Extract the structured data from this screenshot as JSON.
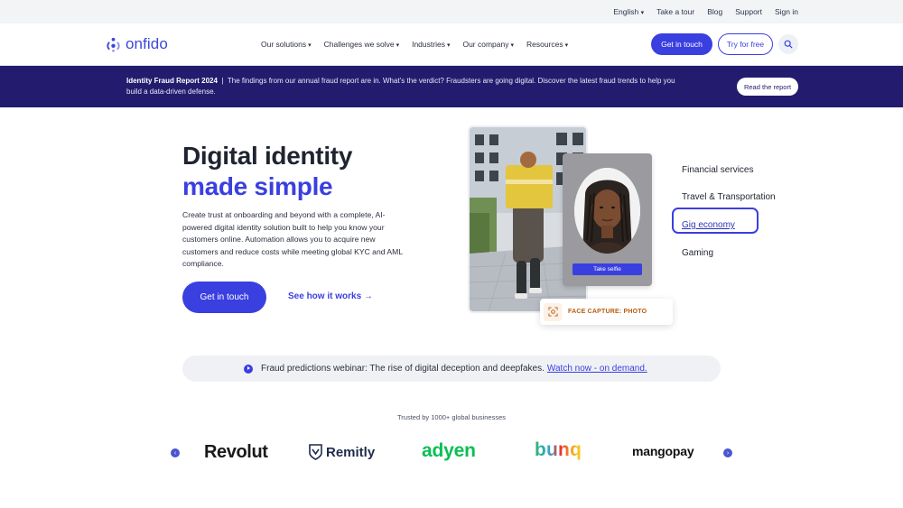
{
  "utility": {
    "language": "English",
    "links": [
      "Take a tour",
      "Blog",
      "Support",
      "Sign in"
    ]
  },
  "nav": {
    "logo_text": "onfido",
    "menu": [
      "Our solutions",
      "Challenges we solve",
      "Industries",
      "Our company",
      "Resources"
    ],
    "cta_label": "Get in touch",
    "try_label": "Try for free",
    "search_icon": "search-icon"
  },
  "banner": {
    "title": "Identity Fraud Report 2024",
    "separator": "|",
    "text": "The findings from our annual fraud report are in. What’s the verdict? Fraudsters are going digital. Discover the latest fraud trends to help you build a data-driven defense.",
    "button": "Read the report"
  },
  "hero": {
    "title_line1": "Digital identity",
    "title_line2": "made simple",
    "description": "Create trust at onboarding and beyond with a complete, AI-powered digital identity solution built to help you know your customers online.  Automation allows you to acquire new customers and reduce costs while meeting global KYC and AML compliance.",
    "cta_label": "Get in touch",
    "link_label": "See how it works →"
  },
  "visual": {
    "selfie_button": "Take selfie",
    "capture_label": "FACE CAPTURE: PHOTO"
  },
  "use_cases": {
    "items": [
      "Financial services",
      "Travel & Transportation",
      "Gig economy",
      "Gaming"
    ],
    "active": "Gig economy"
  },
  "webinar": {
    "text": "Fraud predictions webinar: The rise of digital deception and deepfakes.",
    "link": "Watch now - on demand."
  },
  "logos": {
    "heading": "Trusted by 1000+ global businesses",
    "brands": [
      "Revolut",
      "Remitly",
      "adyen",
      "bunq",
      "mangopay"
    ]
  },
  "colors": {
    "brand": "#3a3fe0",
    "banner_bg": "#231c6e",
    "adyen": "#0abf53",
    "capture_text": "#b85c10"
  }
}
